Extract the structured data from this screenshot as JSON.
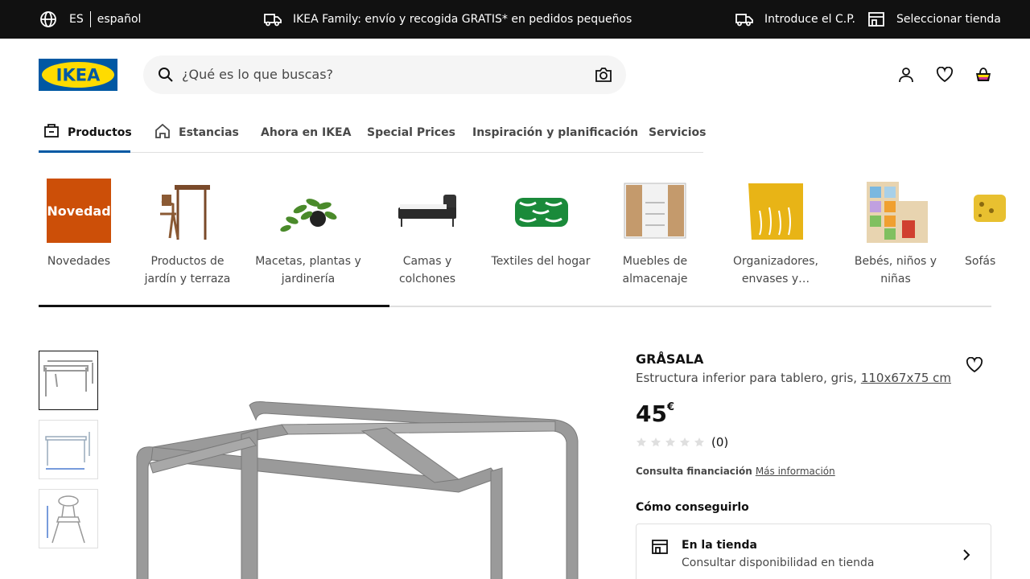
{
  "topbar": {
    "lang_code": "ES",
    "lang_name": "español",
    "promo": "IKEA Family: envío y recogida GRATIS* en pedidos pequeños",
    "postcode": "Introduce el C.P.",
    "store": "Seleccionar tienda"
  },
  "header": {
    "logo_text": "IKEA",
    "search_placeholder": "¿Qué es lo que buscas?"
  },
  "tabs": [
    {
      "label": "Productos",
      "active": true
    },
    {
      "label": "Estancias"
    },
    {
      "label": "Ahora en IKEA"
    },
    {
      "label": "Special Prices"
    },
    {
      "label": "Inspiración y planificación"
    },
    {
      "label": "Servicios"
    }
  ],
  "categories": [
    {
      "label": "Novedades",
      "badge": "Novedad"
    },
    {
      "label": "Productos de jardín y terraza"
    },
    {
      "label": "Macetas, plantas y jardinería"
    },
    {
      "label": "Camas y colchones"
    },
    {
      "label": "Textiles del hogar"
    },
    {
      "label": "Muebles de almacenaje"
    },
    {
      "label": "Organizadores, envases y…"
    },
    {
      "label": "Bebés, niños y niñas"
    },
    {
      "label": "Sofás"
    }
  ],
  "product": {
    "name": "GRÅSALA",
    "desc": "Estructura inferior para tablero, gris,",
    "dims": "110x67x75 cm",
    "price": "45",
    "currency": "€",
    "rating_count": "(0)",
    "financing_label": "Consulta financiación",
    "financing_link": "Más información",
    "how_to_get": "Cómo conseguirlo",
    "store_title": "En la tienda",
    "store_sub": "Consultar disponibilidad en tienda"
  },
  "colors": {
    "ikea_blue": "#0058a3",
    "ikea_yellow": "#ffdb00",
    "topbar_bg": "#111111",
    "novedad_bg": "#cc4f08"
  }
}
